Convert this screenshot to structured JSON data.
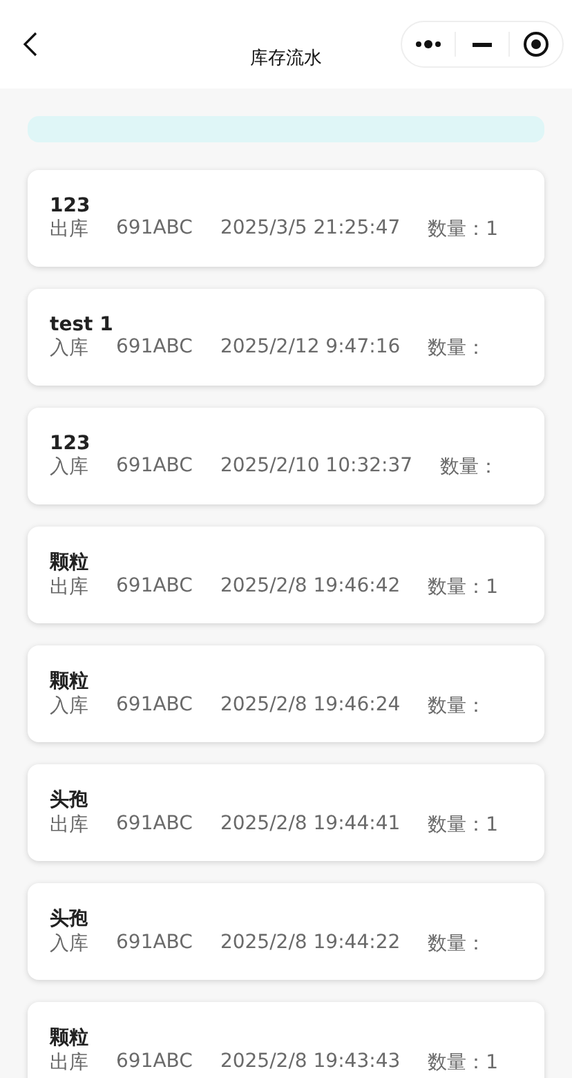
{
  "nav_bar": {
    "title": "库存流水"
  },
  "records": [
    {
      "name": "123",
      "type": "出库",
      "code": "691ABC",
      "time": "2025/3/5 21:25:47",
      "quantity": "数量：1"
    },
    {
      "name": "test 1",
      "type": "入库",
      "code": "691ABC",
      "time": "2025/2/12 9:47:16",
      "quantity": "数量："
    },
    {
      "name": "123",
      "type": "入库",
      "code": "691ABC",
      "time": "2025/2/10 10:32:37",
      "quantity": "数量："
    },
    {
      "name": "颗粒",
      "type": "出库",
      "code": "691ABC",
      "time": "2025/2/8 19:46:42",
      "quantity": "数量：1"
    },
    {
      "name": "颗粒",
      "type": "入库",
      "code": "691ABC",
      "time": "2025/2/8 19:46:24",
      "quantity": "数量："
    },
    {
      "name": "头孢",
      "type": "出库",
      "code": "691ABC",
      "time": "2025/2/8 19:44:41",
      "quantity": "数量：1"
    },
    {
      "name": "头孢",
      "type": "入库",
      "code": "691ABC",
      "time": "2025/2/8 19:44:22",
      "quantity": "数量："
    },
    {
      "name": "颗粒",
      "type": "出库",
      "code": "691ABC",
      "time": "2025/2/8 19:43:43",
      "quantity": "数量：1"
    }
  ]
}
